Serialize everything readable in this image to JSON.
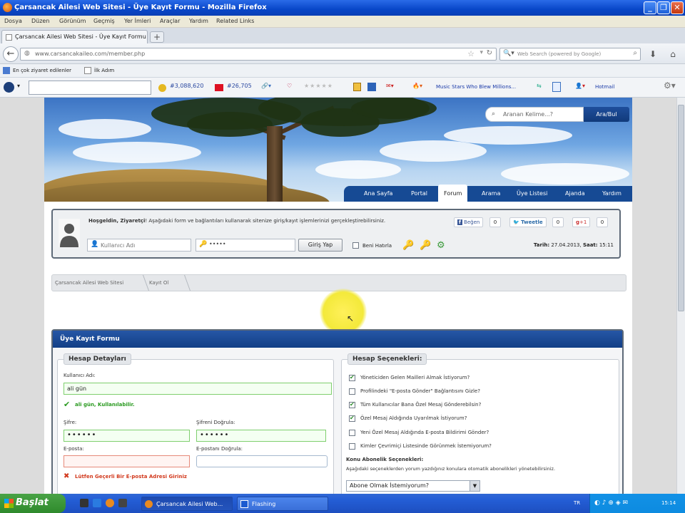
{
  "window": {
    "title": "Çarsancak Ailesi Web Sitesi - Üye Kayıt Formu - Mozilla Firefox"
  },
  "menu": [
    "Dosya",
    "Düzen",
    "Görünüm",
    "Geçmiş",
    "Yer İmleri",
    "Araçlar",
    "Yardım",
    "Related Links"
  ],
  "tab": {
    "label": "Çarsancak Ailesi Web Sitesi - Üye Kayıt Formu"
  },
  "nav": {
    "url": "www.carsancakaileo.com/member.php",
    "search_placeholder": "Web Search (powered by Google)"
  },
  "bookmarks": {
    "most_visited": "En çok ziyaret edilenler",
    "first_steps": "İlk Adım"
  },
  "toolbar2": {
    "count1": "#3,088,620",
    "count2": "#26,705",
    "music_link": "Music Stars Who Blew Millions...",
    "hotmail": "Hotmail"
  },
  "site": {
    "search_placeholder": "Aranan Kelime...?",
    "search_button": "Ara/Bul",
    "nav": [
      "Ana Sayfa",
      "Portal",
      "Forum",
      "Arama",
      "Üye Listesi",
      "Ajanda",
      "Yardım"
    ],
    "active_nav": "Forum",
    "welcome_bold": "Hoşgeldin, Ziyaretçi",
    "welcome_text": "! Aşağıdaki form ve bağlantıları kullanarak sitenize giriş/kayıt işlemlerinizi gerçekleştirebilirsiniz.",
    "like_label": "Beğen",
    "like_count": "0",
    "tweet_label": "Tweetle",
    "tweet_count": "0",
    "gplus_label": "+1",
    "gplus_count": "0",
    "username_placeholder": "Kullanıcı Adı",
    "password_value": "•••••",
    "login_button": "Giriş Yap",
    "remember_me": "Beni Hatırla",
    "date_label": "Tarih:",
    "date_value": "27.04.2013,",
    "time_label": "Saat:",
    "time_value": "15:11",
    "breadcrumb": [
      "Çarsancak Ailesi Web Sitesi",
      "Kayıt Ol"
    ]
  },
  "form": {
    "title": "Üye Kayıt Formu",
    "account_legend": "Hesap Detayları",
    "username_label": "Kullanıcı Adı:",
    "username_value": "ali gün",
    "username_ok": "ali gün, Kullanılabilir.",
    "password_label": "Şifre:",
    "password_value": "••••••",
    "password_confirm_label": "Şifreni Doğrula:",
    "password_confirm_value": "••••••",
    "email_label": "E-posta:",
    "email_confirm_label": "E-postanı Doğrula:",
    "email_error": "Lütfen Geçerli Bir E-posta Adresi Giriniz",
    "options_legend": "Hesap Seçenekleri:",
    "options": [
      {
        "label": "Yöneticiden Gelen Mailleri Almak İstiyorum?",
        "checked": true
      },
      {
        "label": "Profilindeki \"E-posta Gönder\" Bağlantısını Gizle?",
        "checked": false
      },
      {
        "label": "Tüm Kullanıcılar Bana Özel Mesaj Gönderebilsin?",
        "checked": true
      },
      {
        "label": "Özel Mesaj Aldığında Uyarılmak İstiyorum?",
        "checked": true
      },
      {
        "label": "Yeni Özel Mesaj Aldığında E-posta Bildirimi Gönder?",
        "checked": false
      },
      {
        "label": "Kimler Çevrimiçi Listesinde Görünmek İstemiyorum?",
        "checked": false
      }
    ],
    "subscription_title": "Konu Abonelik Seçenekleri:",
    "subscription_desc": "Aşağıdaki seçeneklerden yorum yazdığınız konulara otomatik abonelikleri yönetebilirsiniz.",
    "subscription_value": "Abone Olmak İstemiyorum?"
  },
  "taskbar": {
    "start": "Başlat",
    "window1": "Çarsancak Ailesi Web...",
    "window2": "Flashing",
    "lang": "TR",
    "clock": "15:14"
  }
}
